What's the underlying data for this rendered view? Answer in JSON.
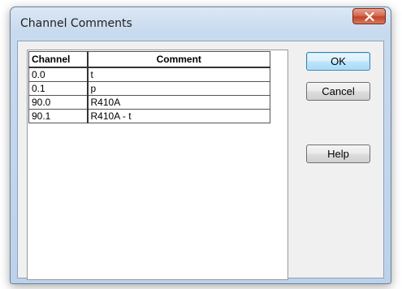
{
  "window": {
    "title": "Channel Comments",
    "close_icon": "close-x-icon"
  },
  "table": {
    "columns": [
      "Channel",
      "Comment"
    ],
    "rows": [
      {
        "channel": "0.0",
        "comment": "t"
      },
      {
        "channel": "0.1",
        "comment": "p"
      },
      {
        "channel": "90.0",
        "comment": "R410A"
      },
      {
        "channel": "90.1",
        "comment": "R410A - t"
      }
    ]
  },
  "buttons": {
    "ok": "OK",
    "cancel": "Cancel",
    "help": "Help"
  }
}
